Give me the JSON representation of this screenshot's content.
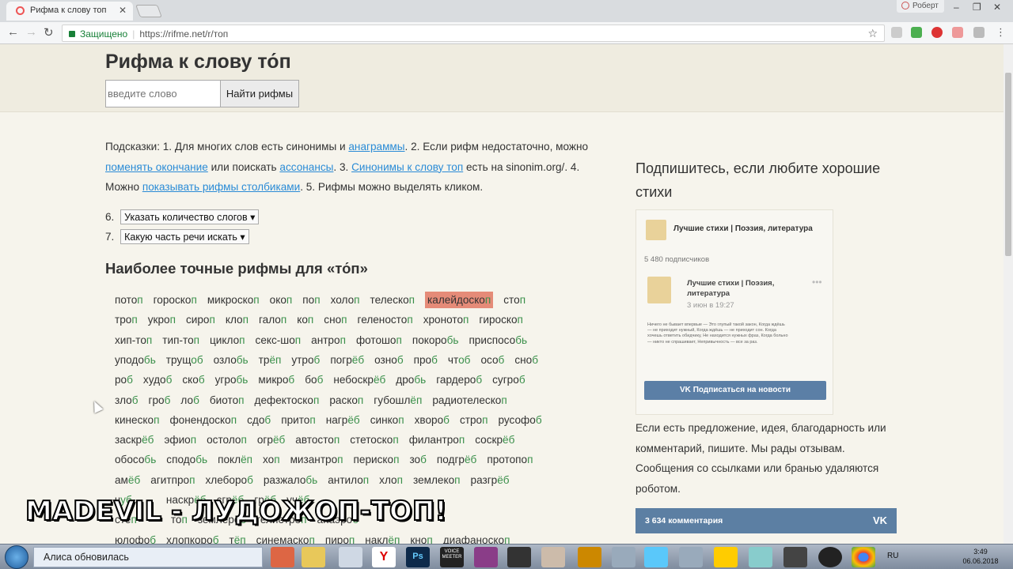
{
  "browser": {
    "tab_title": "Рифма к слову топ",
    "profile_name": "Роберт",
    "secure_label": "Защищено",
    "url": "https://rifme.net/r/топ"
  },
  "page": {
    "title": "Рифма к слову то́п",
    "search_placeholder": "введите слово",
    "search_button": "Найти рифмы",
    "hints": {
      "t1": "Подсказки: 1. Для многих слов есть синонимы и ",
      "l1": "анаграммы",
      "t2": ". 2. Если рифм недостаточно, можно ",
      "l2": "поменять окончание",
      "t3": " или поискать ",
      "l3": "ассонансы",
      "t4": ". 3. ",
      "l4": "Синонимы к слову топ",
      "t5": " есть на sinonim.org/. 4. Можно ",
      "l5": "показывать рифмы столбиками",
      "t6": ". 5. Рифмы можно выделять кликом."
    },
    "option6_num": "6.",
    "option6_label": "Указать количество слогов",
    "option7_num": "7.",
    "option7_label": "Какую часть речи искать",
    "section_title": "Наиболее точные рифмы для «то́п»",
    "rhyme_rows": [
      [
        [
          "пото",
          "п"
        ],
        [
          "гороско",
          "п"
        ],
        [
          "микроско",
          "п"
        ],
        [
          "око",
          "п"
        ],
        [
          "по",
          "п"
        ],
        [
          "холо",
          "п"
        ],
        [
          "телеско",
          "п"
        ],
        [
          "калейдоско",
          "п",
          true
        ],
        [
          "сто",
          "п"
        ]
      ],
      [
        [
          "тро",
          "п"
        ],
        [
          "укро",
          "п"
        ],
        [
          "сиро",
          "п"
        ],
        [
          "кло",
          "п"
        ],
        [
          "гало",
          "п"
        ],
        [
          "ко",
          "п"
        ],
        [
          "сно",
          "п"
        ],
        [
          "геленосто",
          "п"
        ],
        [
          "хроното",
          "п"
        ],
        [
          "гироско",
          "п"
        ]
      ],
      [
        [
          "хип-то",
          "п"
        ],
        [
          "тип-то",
          "п"
        ],
        [
          "цикло",
          "п"
        ],
        [
          "секс-шо",
          "п"
        ],
        [
          "антро",
          "п"
        ],
        [
          "фотошо",
          "п"
        ],
        [
          "покоро",
          "бь"
        ],
        [
          "приспосо",
          "бь"
        ]
      ],
      [
        [
          "уподо",
          "бь"
        ],
        [
          "трущ",
          "об"
        ],
        [
          "озло",
          "бь"
        ],
        [
          "тр",
          "ёп"
        ],
        [
          "утро",
          "б"
        ],
        [
          "погр",
          "ёб"
        ],
        [
          "озно",
          "б"
        ],
        [
          "про",
          "б"
        ],
        [
          "чт",
          "об"
        ],
        [
          "осо",
          "б"
        ],
        [
          "сно",
          "б"
        ]
      ],
      [
        [
          "ро",
          "б"
        ],
        [
          "худо",
          "б"
        ],
        [
          "ско",
          "б"
        ],
        [
          "угро",
          "бь"
        ],
        [
          "микро",
          "б"
        ],
        [
          "бо",
          "б"
        ],
        [
          "небоскр",
          "ёб"
        ],
        [
          "дро",
          "бь"
        ],
        [
          "гардеро",
          "б"
        ],
        [
          "сугро",
          "б"
        ]
      ],
      [
        [
          "зло",
          "б"
        ],
        [
          "гро",
          "б"
        ],
        [
          "ло",
          "б"
        ],
        [
          "биото",
          "п"
        ],
        [
          "дефектоско",
          "п"
        ],
        [
          "раско",
          "п"
        ],
        [
          "губошл",
          "ёп"
        ],
        [
          "радиотелеско",
          "п"
        ]
      ],
      [
        [
          "кинеско",
          "п"
        ],
        [
          "фонендоско",
          "п"
        ],
        [
          "сдо",
          "б"
        ],
        [
          "прито",
          "п"
        ],
        [
          "нагр",
          "ёб"
        ],
        [
          "синко",
          "п"
        ],
        [
          "хворо",
          "б"
        ],
        [
          "стро",
          "п"
        ],
        [
          "русофо",
          "б"
        ]
      ],
      [
        [
          "заскр",
          "ёб"
        ],
        [
          "эфио",
          "п"
        ],
        [
          "остоло",
          "п"
        ],
        [
          "огр",
          "ёб"
        ],
        [
          "автосто",
          "п"
        ],
        [
          "стетоско",
          "п"
        ],
        [
          "филантро",
          "п"
        ],
        [
          "соскр",
          "ёб"
        ]
      ],
      [
        [
          "обосо",
          "бь"
        ],
        [
          "сподо",
          "бь"
        ],
        [
          "покл",
          "ёп"
        ],
        [
          "хо",
          "п"
        ],
        [
          "мизантро",
          "п"
        ],
        [
          "периско",
          "п"
        ],
        [
          "зо",
          "б"
        ],
        [
          "подгр",
          "ёб"
        ],
        [
          "протопо",
          "п"
        ]
      ],
      [
        [
          "ам",
          "ёб"
        ],
        [
          "агитпро",
          "п"
        ],
        [
          "хлеборо",
          "б"
        ],
        [
          "разжало",
          "бь"
        ],
        [
          "антило",
          "п"
        ],
        [
          "хло",
          "п"
        ],
        [
          "землеко",
          "п"
        ],
        [
          "разгр",
          "ёб"
        ]
      ],
      [
        [
          "ч",
          "уб"
        ],
        [
          "",
          "",
          "",
          false
        ],
        [
          "наскр",
          "ёб"
        ],
        [
          "сгр",
          "ёб"
        ],
        [
          "гр",
          "ёб"
        ],
        [
          "уч",
          "ёб"
        ]
      ],
      [
        [
          "сте",
          "п"
        ],
        [
          "",
          "",
          "",
          false
        ],
        [
          "то",
          "п"
        ],
        [
          "землеро",
          "б"
        ],
        [
          "гелиотро",
          "п"
        ],
        [
          "анаэро",
          "б"
        ]
      ],
      [
        [
          "юлофо",
          "б"
        ],
        [
          "хлопкоро",
          "б"
        ],
        [
          "т",
          "ёп"
        ],
        [
          "синемаско",
          "п"
        ],
        [
          "пиро",
          "п"
        ],
        [
          "накл",
          "ёп"
        ],
        [
          "кно",
          "п"
        ],
        [
          "диафаноско",
          "п"
        ]
      ]
    ]
  },
  "sidebar": {
    "title": "Подпишитесь, если любите хорошие стихи",
    "vk_group": "Лучшие стихи | Поэзия, литература",
    "vk_subscribers": "5 480 подписчиков",
    "vk_post_title": "Лучшие стихи | Поэзия, литература",
    "vk_post_date": "3 июн в 19:27",
    "vk_post_text": "Ничего не бывает впервые — Это глупый такой закон, Когда ждёшь — не приходит нужный, Когда ждёшь — не приходит сон. Когда хочешь ответить обидчику, Не находится нужных фраз, Когда больно — никто не спрашивает, Непривычность — все за раз.",
    "vk_subscribe_btn": "Подписаться на новости",
    "note": "Если есть предложение, идея, благодарность или комментарий, пишите. Мы рады отзывам. Сообщения со ссылками или бранью удаляются роботом.",
    "comments": "3 634 комментария"
  },
  "overlay_text": "MADEVIL - ЛУДОЖОП-ТОП!",
  "taskbar": {
    "notification": "Алиса обновилась",
    "lang": "RU",
    "time": "3:49",
    "date": "06.06.2018"
  }
}
